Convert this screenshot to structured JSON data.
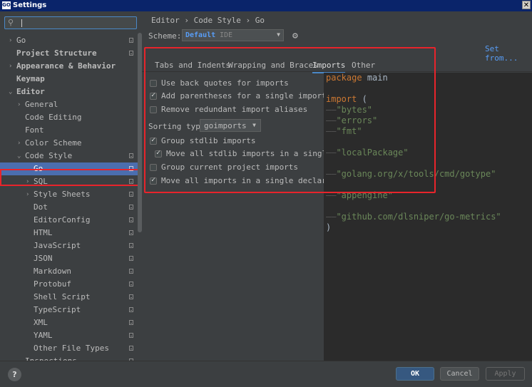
{
  "window": {
    "title": "Settings",
    "app_icon_text": "GO",
    "close_glyph": "✕"
  },
  "search": {
    "placeholder": "",
    "value": "",
    "icon": "search-icon"
  },
  "tree": [
    {
      "label": "Go",
      "arrow": "›",
      "indent": 0,
      "bold": false,
      "project": true,
      "selected": false
    },
    {
      "label": "Project Structure",
      "arrow": "",
      "indent": 0,
      "bold": true,
      "project": true,
      "selected": false
    },
    {
      "label": "Appearance & Behavior",
      "arrow": "›",
      "indent": 0,
      "bold": true,
      "project": false,
      "selected": false
    },
    {
      "label": "Keymap",
      "arrow": "",
      "indent": 0,
      "bold": true,
      "project": false,
      "selected": false
    },
    {
      "label": "Editor",
      "arrow": "⌄",
      "indent": 0,
      "bold": true,
      "project": false,
      "selected": false
    },
    {
      "label": "General",
      "arrow": "›",
      "indent": 1,
      "bold": false,
      "project": false,
      "selected": false
    },
    {
      "label": "Code Editing",
      "arrow": "",
      "indent": 1,
      "bold": false,
      "project": false,
      "selected": false
    },
    {
      "label": "Font",
      "arrow": "",
      "indent": 1,
      "bold": false,
      "project": false,
      "selected": false
    },
    {
      "label": "Color Scheme",
      "arrow": "›",
      "indent": 1,
      "bold": false,
      "project": false,
      "selected": false
    },
    {
      "label": "Code Style",
      "arrow": "⌄",
      "indent": 1,
      "bold": false,
      "project": true,
      "selected": false
    },
    {
      "label": "Go",
      "arrow": "",
      "indent": 2,
      "bold": false,
      "project": true,
      "selected": true
    },
    {
      "label": "SQL",
      "arrow": "›",
      "indent": 2,
      "bold": false,
      "project": true,
      "selected": false
    },
    {
      "label": "Style Sheets",
      "arrow": "›",
      "indent": 2,
      "bold": false,
      "project": true,
      "selected": false
    },
    {
      "label": "Dot",
      "arrow": "",
      "indent": 2,
      "bold": false,
      "project": true,
      "selected": false
    },
    {
      "label": "EditorConfig",
      "arrow": "",
      "indent": 2,
      "bold": false,
      "project": true,
      "selected": false
    },
    {
      "label": "HTML",
      "arrow": "",
      "indent": 2,
      "bold": false,
      "project": true,
      "selected": false
    },
    {
      "label": "JavaScript",
      "arrow": "",
      "indent": 2,
      "bold": false,
      "project": true,
      "selected": false
    },
    {
      "label": "JSON",
      "arrow": "",
      "indent": 2,
      "bold": false,
      "project": true,
      "selected": false
    },
    {
      "label": "Markdown",
      "arrow": "",
      "indent": 2,
      "bold": false,
      "project": true,
      "selected": false
    },
    {
      "label": "Protobuf",
      "arrow": "",
      "indent": 2,
      "bold": false,
      "project": true,
      "selected": false
    },
    {
      "label": "Shell Script",
      "arrow": "",
      "indent": 2,
      "bold": false,
      "project": true,
      "selected": false
    },
    {
      "label": "TypeScript",
      "arrow": "",
      "indent": 2,
      "bold": false,
      "project": true,
      "selected": false
    },
    {
      "label": "XML",
      "arrow": "",
      "indent": 2,
      "bold": false,
      "project": true,
      "selected": false
    },
    {
      "label": "YAML",
      "arrow": "",
      "indent": 2,
      "bold": false,
      "project": true,
      "selected": false
    },
    {
      "label": "Other File Types",
      "arrow": "",
      "indent": 2,
      "bold": false,
      "project": true,
      "selected": false
    },
    {
      "label": "Inspections",
      "arrow": "",
      "indent": 1,
      "bold": false,
      "project": true,
      "selected": false
    }
  ],
  "breadcrumb": {
    "text": "Editor  ›  Code Style  ›  Go"
  },
  "scheme": {
    "label": "Scheme:",
    "name": "Default",
    "kind": "IDE",
    "dropdown_glyph": "▼",
    "gear_icon": "gear-icon"
  },
  "set_from": "Set from...",
  "tabs": [
    "Tabs and Indents",
    "Wrapping and Braces",
    "Imports",
    "Other"
  ],
  "active_tab": 2,
  "options": {
    "use_back_quotes": {
      "label": "Use back quotes for imports",
      "checked": false
    },
    "add_parentheses": {
      "label": "Add parentheses for a single import",
      "checked": true
    },
    "remove_redundant": {
      "label": "Remove redundant import aliases",
      "checked": false
    },
    "group_stdlib": {
      "label": "Group stdlib imports",
      "checked": true
    },
    "move_stdlib_single": {
      "label": "Move all stdlib imports in a single group",
      "checked": true
    },
    "group_project": {
      "label": "Group current project imports",
      "checked": false
    },
    "move_all_single": {
      "label": "Move all imports in a single declaration",
      "checked": true
    }
  },
  "sorting": {
    "label": "Sorting type",
    "value": "goimports",
    "dropdown_glyph": "▼"
  },
  "code_preview": {
    "package_kw": "package",
    "package_name": "main",
    "import_kw": "import",
    "open_paren": "(",
    "guide": "——",
    "imports": [
      "\"bytes\"",
      "\"errors\"",
      "\"fmt\"",
      "\"localPackage\"",
      "\"golang.org/x/tools/cmd/gotype\"",
      "\"appengine\"",
      "\"github.com/dlsniper/go-metrics\""
    ],
    "close_paren": ")"
  },
  "footer": {
    "help": "?",
    "ok": "OK",
    "cancel": "Cancel",
    "apply": "Apply"
  },
  "colors": {
    "accent": "#4a88c7",
    "selection": "#4b6eaf",
    "annotation_red": "#e8242b",
    "keyword": "#cc7832",
    "string": "#6a8759"
  }
}
